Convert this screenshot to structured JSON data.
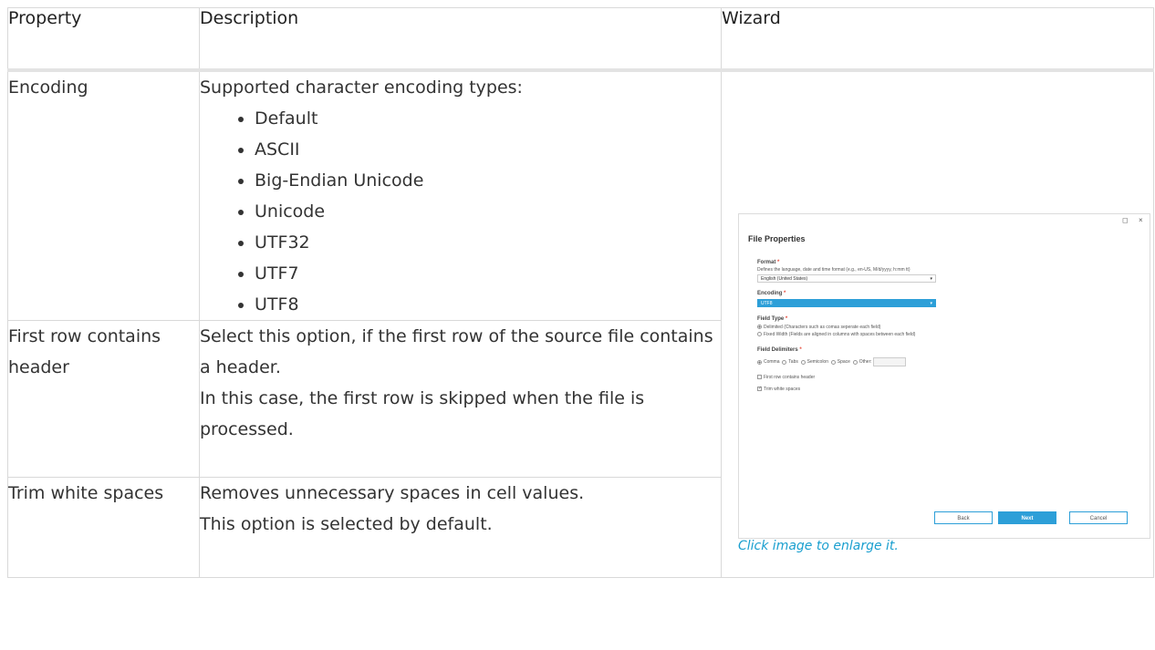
{
  "headers": {
    "property": "Property",
    "description": "Description",
    "wizard": "Wizard"
  },
  "rows": [
    {
      "property": "Encoding",
      "description_intro": "Supported character encoding types:",
      "encodings": [
        "Default",
        "ASCII",
        "Big-Endian Unicode",
        "Unicode",
        "UTF32",
        "UTF7",
        "UTF8"
      ]
    },
    {
      "property": "First row contains header",
      "description_lines": [
        "Select this option, if the first row of the source file contains a header.",
        "In this case, the first row is skipped when the file is processed."
      ]
    },
    {
      "property": "Trim white spaces",
      "description_lines": [
        "Removes unnecessary spaces in cell values.",
        "This option is selected by default."
      ]
    }
  ],
  "wizard": {
    "caption": "Click image to enlarge it.",
    "dialog": {
      "title": "File Properties",
      "maximize_glyph": "◻",
      "close_glyph": "×",
      "format_label": "Format",
      "format_help": "Defines the language, date and time format (e.g., en-US, M/d/yyyy, h:mm tt)",
      "format_value": "English (United States)",
      "encoding_label": "Encoding",
      "encoding_value": "UTF8",
      "field_type_label": "Field Type",
      "field_type_options": [
        "Delimited (Characters such as comas seperate each field)",
        "Fixed Width (Fields are aligned in columns with spaces between each field)"
      ],
      "field_delimiters_label": "Field Delimiters",
      "delimiters": [
        "Comma",
        "Tabs",
        "Semicolon",
        "Space",
        "Other:"
      ],
      "first_row_label": "First row contains header",
      "trim_label": "Trim white spaces",
      "required_mark": "*",
      "check_mark": "✓",
      "back_label": "Back",
      "next_label": "Next",
      "cancel_label": "Cancel"
    }
  },
  "colors": {
    "accent": "#2d9fd8",
    "link": "#1a9fcf",
    "border": "#d9d9d9"
  }
}
